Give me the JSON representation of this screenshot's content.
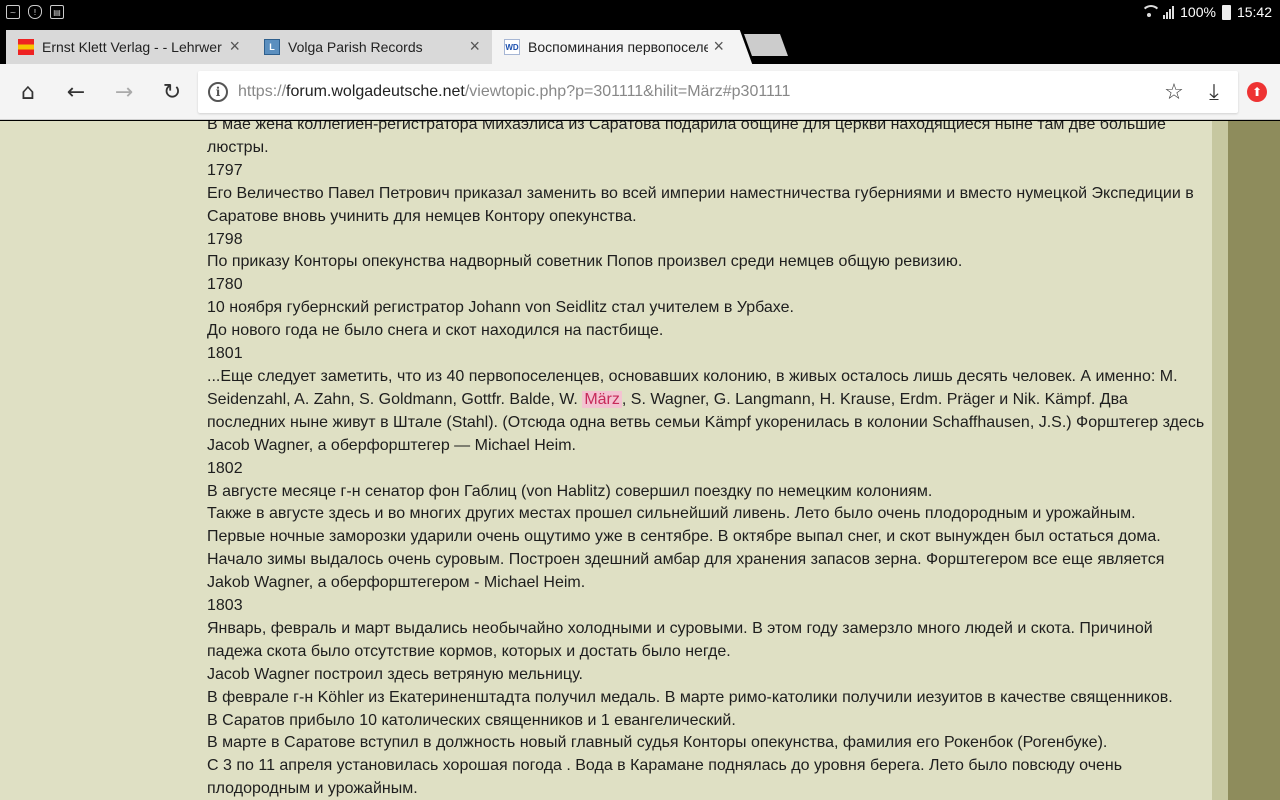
{
  "status_bar": {
    "battery": "100%",
    "time": "15:42"
  },
  "tabs": [
    {
      "title": "Ernst Klett Verlag - - Lehrwerke",
      "favicon": "klett-icon"
    },
    {
      "title": "Volga Parish Records",
      "favicon": "volga-icon",
      "fav_letter": "L"
    },
    {
      "title": "Воспоминания первопоселенцев",
      "favicon": "wd-icon",
      "fav_letter": "WD"
    }
  ],
  "omnibox": {
    "scheme": "https://",
    "host": "forum.wolgadeutsche.net",
    "path": "/viewtopic.php?p=301111&hilit=März#p301111"
  },
  "content": {
    "lines": [
      "В мае жена коллегиен-регистратора Михаэлиса из Саратова подарила общине для церкви находящиеся ныне там две большие люстры.",
      "1797",
      "Его Величество Павел Петрович приказал заменить во всей империи наместничества губерниями и вместо нумецкой Экспедиции в Саратове вновь учинить для немцев Контору опекунства.",
      "1798",
      "По приказу Конторы опекунства надворный советник Попов произвел среди немцев общую ревизию.",
      "1780",
      "10 ноября губернский регистратор Johann von Seidlitz стал учителем в Урбахе.",
      "До нового года не было снега и скот находился на пастбище.",
      "1801"
    ],
    "para_1801_before": "...Еще следует заметить, что из 40 первопоселенцев, основавших колонию, в живых осталось лишь десять человек. А именно: M. Seidenzahl, A. Zahn, S. Goldmann, Gottfr. Balde, W. ",
    "highlight": "März",
    "para_1801_after": ", S. Wagner, G. Langmann, H. Krause, Erdm. Präger и Nik. Kämpf. Два последних ныне живут в Штале (Stahl). (Отсюда одна ветвь семьи Kämpf укоренилась в колонии Schaffhausen, J.S.) Форштегер здесь Jacob Wagner, а оберфорштегер — Michael Heim.",
    "lines2": [
      "1802",
      "В августе месяце г-н сенатор фон Габлиц (von Hablitz) совершил поездку по немецким колониям.",
      "Также в августе здесь и во многих других местах прошел сильнейший ливень. Лето было очень плодородным и урожайным.",
      "Первые ночные заморозки ударили очень ощутимо уже в сентябре. В октябре выпал снег, и скот вынужден был остаться дома.",
      "Начало зимы выдалось очень суровым. Построен здешний амбар для хранения запасов зерна. Форштегером все еще является Jakob Wagner, а оберфорштегером - Michael Heim.",
      "1803",
      "Январь, февраль и март выдались необычайно холодными и суровыми. В этом году замерзло много людей и скота. Причиной падежа скота было отсутствие кормов, которых и достать было негде.",
      "Jacob Wagner построил здесь ветряную мельницу.",
      "В феврале г-н Köhler из Екатериненштадта получил медаль. В марте римо-католики получили иезуитов в качестве священников.",
      "В Саратов прибыло 10 католических священников и 1 евангелический.",
      "В марте в Саратове вступил в должность новый главный судья Конторы опекунства, фамилия его Рокенбок (Рогенбуке).",
      "С 3 по 11 апреля установилась хорошая погода . Вода в Карамане поднялась до уровня берега. Лето было повсюду очень плодородным и урожайным."
    ]
  }
}
